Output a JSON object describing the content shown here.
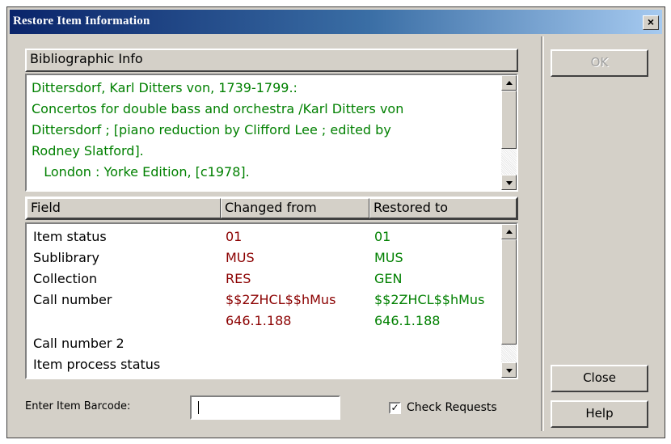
{
  "window": {
    "title": "Restore Item Information",
    "close_glyph": "×"
  },
  "biblio": {
    "header": "Bibliographic Info",
    "lines": [
      "Dittersdorf, Karl Ditters von, 1739-1799.:",
      "Concertos for double bass and orchestra /Karl Ditters von",
      "Dittersdorf ; [piano reduction by Clifford Lee ; edited by",
      "Rodney Slatford].",
      "   London : Yorke Edition, [c1978]."
    ],
    "text_color": "#008000"
  },
  "table": {
    "headers": {
      "field": "Field",
      "changed_from": "Changed from",
      "restored_to": "Restored to"
    },
    "rows": [
      {
        "field": "Item status",
        "changed_from": "01",
        "restored_to": "01"
      },
      {
        "field": "Sublibrary",
        "changed_from": "MUS",
        "restored_to": "MUS"
      },
      {
        "field": "Collection",
        "changed_from": "RES",
        "restored_to": "GEN"
      },
      {
        "field": "Call number",
        "changed_from": "$$2ZHCL$$hMus",
        "restored_to": "$$2ZHCL$$hMus"
      },
      {
        "field": "",
        "changed_from": "646.1.188",
        "restored_to": "646.1.188"
      },
      {
        "field": "Call number 2",
        "changed_from": "",
        "restored_to": ""
      },
      {
        "field": "Item process status",
        "changed_from": "",
        "restored_to": ""
      }
    ],
    "changed_from_color": "#8b0000",
    "restored_to_color": "#008000"
  },
  "buttons": {
    "ok": "OK",
    "close": "Close",
    "help": "Help"
  },
  "barcode": {
    "label": "Enter Item Barcode:",
    "value": ""
  },
  "check_requests": {
    "label": "Check Requests",
    "checked": true,
    "glyph": "✓"
  }
}
